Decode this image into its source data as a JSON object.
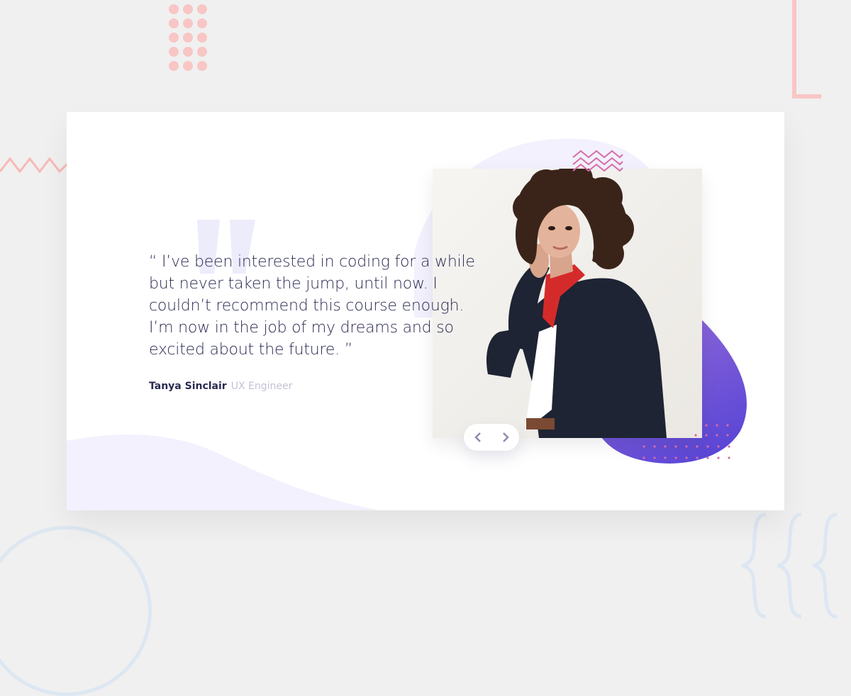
{
  "testimonial": {
    "quote": "“ I’ve been interested in coding for a while but never taken the jump, until now. I couldn’t recommend this course enough. I’m now in the job of my dreams and so excited about the future. ”",
    "author_name": "Tanya Sinclair",
    "author_role": "UX Engineer"
  },
  "navigation": {
    "prev_icon": "chevron-left-icon",
    "next_icon": "chevron-right-icon"
  },
  "colors": {
    "background": "#f0f0f0",
    "card": "#ffffff",
    "text_dark": "#2a2a52",
    "text_muted": "#c2c2d6",
    "accent_purple": "#6a4fd8",
    "accent_violet": "#9b6fd9",
    "deco_pink": "#f8c6c4",
    "zigzag_pink": "#d86aa8",
    "quote_mark": "#ececfb"
  }
}
